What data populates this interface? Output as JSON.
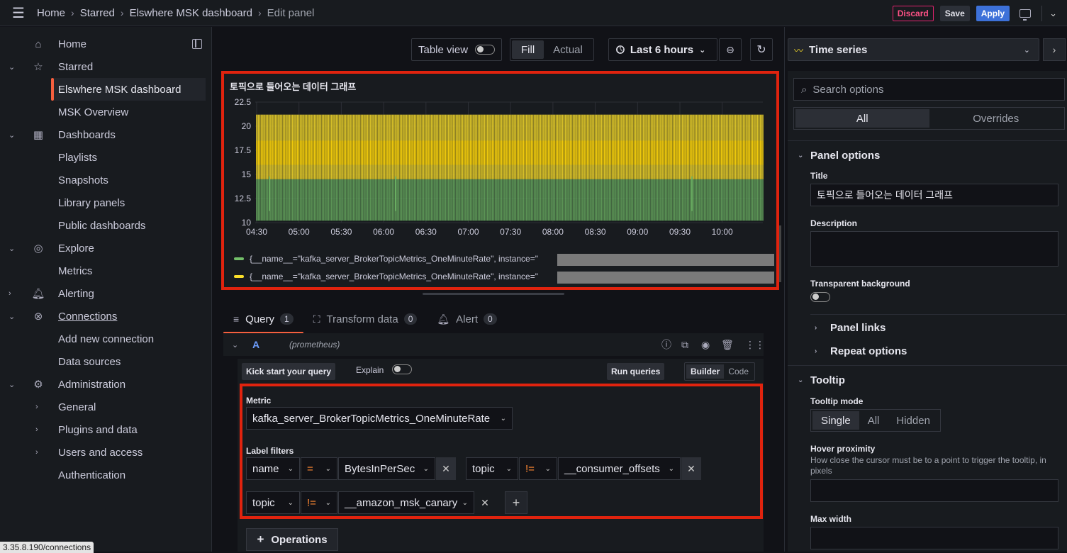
{
  "breadcrumb": [
    "Home",
    "Starred",
    "Elswhere MSK dashboard",
    "Edit panel"
  ],
  "toolbar": {
    "discard": "Discard",
    "save": "Save",
    "apply": "Apply"
  },
  "sidebar": {
    "items": [
      {
        "label": "Home",
        "icon": "home-icon"
      },
      {
        "label": "Starred",
        "icon": "star-icon",
        "expanded": true
      },
      {
        "label": "Elswhere MSK dashboard",
        "active": true
      },
      {
        "label": "MSK Overview"
      },
      {
        "label": "Dashboards",
        "icon": "apps-icon",
        "expanded": true
      },
      {
        "label": "Playlists"
      },
      {
        "label": "Snapshots"
      },
      {
        "label": "Library panels"
      },
      {
        "label": "Public dashboards"
      },
      {
        "label": "Explore",
        "icon": "compass-icon",
        "expanded": true
      },
      {
        "label": "Metrics"
      },
      {
        "label": "Alerting",
        "icon": "bell-icon",
        "expanded": false
      },
      {
        "label": "Connections",
        "icon": "connections-icon",
        "expanded": true
      },
      {
        "label": "Add new connection"
      },
      {
        "label": "Data sources"
      },
      {
        "label": "Administration",
        "icon": "gear-icon",
        "expanded": true
      },
      {
        "label": "General"
      },
      {
        "label": "Plugins and data"
      },
      {
        "label": "Users and access"
      },
      {
        "label": "Authentication"
      }
    ]
  },
  "status_url": "3.35.8.190/connections",
  "panel_toolbar": {
    "table_view": "Table view",
    "fill": "Fill",
    "actual": "Actual",
    "time_range": "Last 6 hours"
  },
  "panel": {
    "title": "토픽으로 들어오는 데이터 그래프",
    "legend": [
      {
        "text": "{__name__=\"kafka_server_BrokerTopicMetrics_OneMinuteRate\", instance=\"",
        "color": "#73bf69"
      },
      {
        "text": "{__name__=\"kafka_server_BrokerTopicMetrics_OneMinuteRate\", instance=\"",
        "color": "#fade2a"
      }
    ]
  },
  "chart_data": {
    "type": "area",
    "title": "토픽으로 들어오는 데이터 그래프",
    "x_ticks": [
      "04:30",
      "05:00",
      "05:30",
      "06:00",
      "06:30",
      "07:00",
      "07:30",
      "08:00",
      "08:30",
      "09:00",
      "09:30",
      "10:00"
    ],
    "y_ticks": [
      10,
      12.5,
      15,
      17.5,
      20,
      22.5
    ],
    "ylim": [
      10,
      22.5
    ],
    "series": [
      {
        "color": "#73bf69",
        "min": 10.2,
        "max": 14.5
      },
      {
        "color": "#fade2a",
        "min": 14.5,
        "max": 21.2
      }
    ],
    "grid": true
  },
  "tabs": [
    {
      "label": "Query",
      "count": "1"
    },
    {
      "label": "Transform data",
      "count": "0"
    },
    {
      "label": "Alert",
      "count": "0"
    }
  ],
  "query": {
    "ref": "A",
    "datasource": "(prometheus)",
    "kick_start": "Kick start your query",
    "explain": "Explain",
    "run": "Run queries",
    "builder": "Builder",
    "code": "Code",
    "metric_label": "Metric",
    "metric": "kafka_server_BrokerTopicMetrics_OneMinuteRate",
    "label_filters": "Label filters",
    "filters": [
      {
        "label": "name",
        "op": "=",
        "value": "BytesInPerSec"
      },
      {
        "label": "topic",
        "op": "!=",
        "value": "__consumer_offsets"
      },
      {
        "label": "topic",
        "op": "!=",
        "value": "__amazon_msk_canary"
      }
    ],
    "operations": "Operations"
  },
  "options": {
    "viz": "Time series",
    "search_placeholder": "Search options",
    "all": "All",
    "overrides": "Overrides",
    "panel_options": "Panel options",
    "title_label": "Title",
    "title_value": "토픽으로 들어오는 데이터 그래프",
    "description": "Description",
    "transparent": "Transparent background",
    "panel_links": "Panel links",
    "repeat_options": "Repeat options",
    "tooltip": "Tooltip",
    "tooltip_mode": "Tooltip mode",
    "modes": [
      "Single",
      "All",
      "Hidden"
    ],
    "hover": "Hover proximity",
    "hover_desc": "How close the cursor must be to a point to trigger the tooltip, in pixels",
    "max_width": "Max width"
  }
}
